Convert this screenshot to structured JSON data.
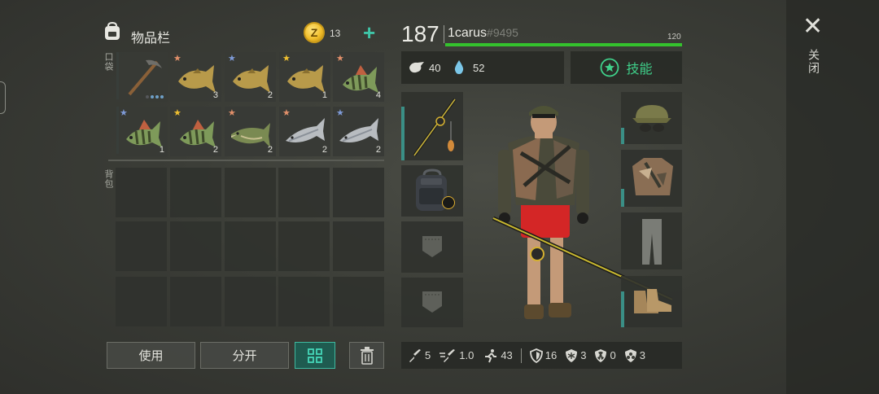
{
  "inventory": {
    "title": "物品栏",
    "coins": "13",
    "add_label": "+",
    "pocket_label": "口袋",
    "backpack_label": "背包",
    "pocket_items": [
      {
        "name": "pickaxe",
        "quantity": "",
        "star_color": "",
        "durability": "3 of 3 dots, partially used"
      },
      {
        "name": "carp",
        "quantity": "3",
        "star_color": "#e2906a"
      },
      {
        "name": "carp",
        "quantity": "2",
        "star_color": "#7f9bd8"
      },
      {
        "name": "carp",
        "quantity": "1",
        "star_color": "#f0c030"
      },
      {
        "name": "perch",
        "quantity": "4",
        "star_color": "#e2906a"
      },
      {
        "name": "perch",
        "quantity": "1",
        "star_color": "#7f9bd8"
      },
      {
        "name": "perch",
        "quantity": "2",
        "star_color": "#f0c030"
      },
      {
        "name": "pike",
        "quantity": "2",
        "star_color": "#e2906a"
      },
      {
        "name": "salmon",
        "quantity": "2",
        "star_color": "#e2906a"
      },
      {
        "name": "salmon",
        "quantity": "2",
        "star_color": "#7f9bd8"
      }
    ],
    "backpack_slots": 15
  },
  "buttons": {
    "use": "使用",
    "split": "分开"
  },
  "character": {
    "level": "187",
    "name": "1carus",
    "tag": "#9495",
    "xp_max": "120",
    "xp_fill": 1.0,
    "hunger": "40",
    "thirst": "52",
    "skills_label": "技能"
  },
  "equipment": {
    "left": [
      "fishing-rod",
      "backpack",
      "empty-pocket",
      "empty-pocket"
    ],
    "right": [
      "camo-cap",
      "camo-jacket",
      "gray-pants",
      "leather-boots"
    ]
  },
  "stats": [
    {
      "icon": "sword-icon",
      "value": "5"
    },
    {
      "icon": "attack-speed-icon",
      "value": "1.0"
    },
    {
      "icon": "run-speed-icon",
      "value": "43"
    },
    {
      "icon": "armor-icon",
      "value": "16"
    },
    {
      "icon": "cold-resist-icon",
      "value": "3"
    },
    {
      "icon": "radiation-icon",
      "value": "0"
    },
    {
      "icon": "toxic-icon",
      "value": "3"
    }
  ],
  "close": {
    "label": "关闭"
  },
  "colors": {
    "accent": "#3fc5a8",
    "xp_bar": "#34c22d",
    "skill_green": "#3fd08a"
  }
}
